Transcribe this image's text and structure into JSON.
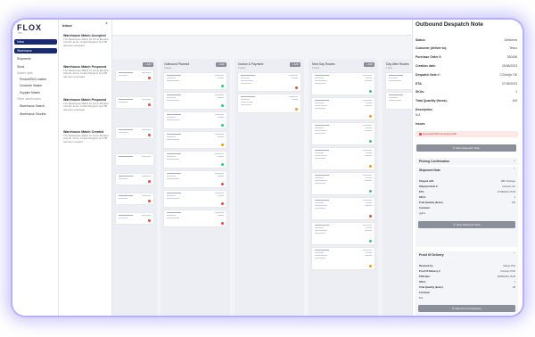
{
  "brand": {
    "logo": "FLOX",
    "sub": "3PL"
  },
  "leftnav": {
    "items": [
      {
        "label": "Inbox",
        "active": true
      },
      {
        "label": "Warehouse",
        "active": true
      },
      {
        "label": "Shipments",
        "active": false
      },
      {
        "label": "Stock",
        "active": false
      },
      {
        "label": "Master data",
        "group": true
      },
      {
        "label": "Product/SKU master",
        "sub": true
      },
      {
        "label": "Customer Master",
        "sub": true
      },
      {
        "label": "Supplier Master",
        "sub": true
      },
      {
        "label": "Other warehouses",
        "group": true
      },
      {
        "label": "Warehouse Search",
        "sub": true
      },
      {
        "label": "Warehouse Shortlist",
        "sub": true
      }
    ]
  },
  "inbox": {
    "title": "Inbox",
    "close": "×",
    "messages": [
      {
        "title": "Warehouse Match Accepted",
        "body": "The Warehouse Match for Acme Bonded Unit 3A, Acme, United Kingdom by FTB has been accepted"
      },
      {
        "title": "Warehouse Match Proposed",
        "body": "The Warehouse Match for Acme Bonded Unit 3A, Acme, United Kingdom by FTB has been proposed"
      },
      {
        "title": "Warehouse Match Proposed",
        "body": "The Warehouse Match for Acme Bonded Unit 3A, Acme, United Kingdom by FTB has been proposed"
      },
      {
        "title": "Warehouse Match Created",
        "body": "The Warehouse Match for Acme Bonded Unit 3A, Acme, United Kingdom by FTB has been created"
      }
    ]
  },
  "board": {
    "add_label": "+ Add",
    "columns": [
      {
        "name": "",
        "count": ""
      },
      {
        "name": "Outbound Planned",
        "count": "3 items"
      },
      {
        "name": "Invoice & Payment",
        "count": "2 items"
      },
      {
        "name": "Next Day Routes",
        "count": "5 items"
      },
      {
        "name": "Day After Routes",
        "count": "1 item"
      }
    ]
  },
  "panel": {
    "title": "Outbound Despatch Note",
    "fields": [
      {
        "k": "Status:",
        "v": "Delivered"
      },
      {
        "k": "Customer (deliver to):",
        "v": "Tesco"
      },
      {
        "k": "Purchase Order #:",
        "v": "330436"
      },
      {
        "k": "Creation date:",
        "v": "25/08/2023"
      },
      {
        "k": "Despatch Note #:",
        "v": "CG/outpr OK"
      },
      {
        "k": "ETA:",
        "v": "27/08/2023"
      },
      {
        "k": "SKUs:",
        "v": "1"
      },
      {
        "k": "Total Quantity (Items):",
        "v": "100"
      }
    ],
    "description_label": "Description",
    "description_value": "N/A",
    "issues_label": "Issues",
    "issue_text": "Expected 100 but received 98",
    "view_despatch": "View Despatch Note",
    "picking": "Picking Confirmation",
    "shipment_note": "Shipment Note",
    "shipment_fields": [
      {
        "k": "Shipped with:",
        "v": "DBC Package"
      },
      {
        "k": "Shipment Note #:",
        "v": "CG/outpr OK"
      },
      {
        "k": "ETA:",
        "v": "27/08/2023 15:05"
      },
      {
        "k": "SKUs:",
        "v": "1"
      },
      {
        "k": "Total Quantity (Items):",
        "v": "100"
      }
    ],
    "comment_label": "Comment",
    "comment_value": "gg5ne",
    "view_shipment": "View Shipment Note",
    "proof": "Proof Of Delivery",
    "proof_fields": [
      {
        "k": "Received by:",
        "v": "Wasgo Pick"
      },
      {
        "k": "Proof Of Delivery #:",
        "v": "CG/outpr POD"
      },
      {
        "k": "POD date:",
        "v": "28/08/2023 15:05"
      },
      {
        "k": "SKUs:",
        "v": "1"
      },
      {
        "k": "Total Quantity (Items):",
        "v": "98"
      }
    ],
    "comment2_value": "N/A",
    "view_proof": "View Proof Of Delivery"
  },
  "colors": {
    "accent": "#1a2b6d",
    "danger": "#e74c3c",
    "success": "#2ecc71",
    "warning": "#f39c12"
  }
}
